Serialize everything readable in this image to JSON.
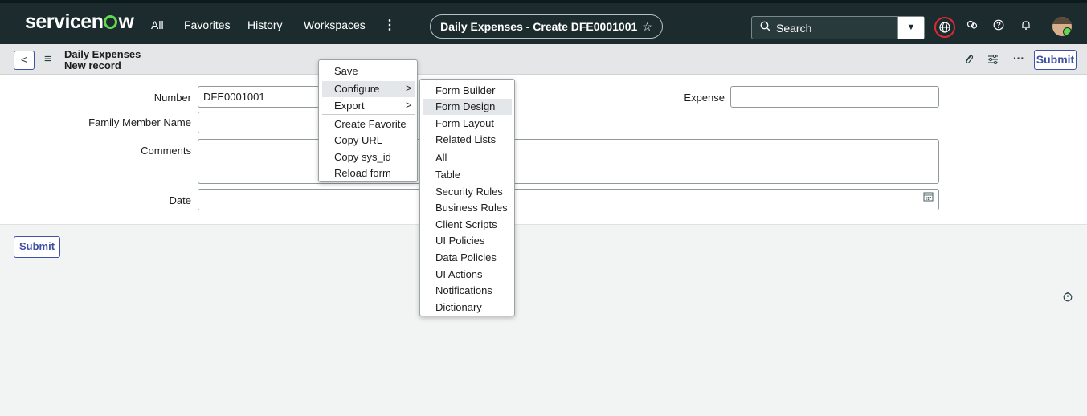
{
  "header": {
    "logo_before": "servicen",
    "logo_after": "w",
    "nav": [
      "All",
      "Favorites",
      "History",
      "Workspaces",
      "⋮"
    ],
    "record_title": "Daily Expenses - Create DFE0001001",
    "search_placeholder": "Search"
  },
  "subheader": {
    "breadcrumb_title": "Daily Expenses",
    "breadcrumb_subtitle": "New record",
    "submit_label": "Submit"
  },
  "form": {
    "number_label": "Number",
    "number_value": "DFE0001001",
    "family_member_label": "Family Member Name",
    "family_member_value": "",
    "expense_label": "Expense",
    "expense_value": "",
    "comments_label": "Comments",
    "comments_value": "",
    "date_label": "Date",
    "date_value": ""
  },
  "footer": {
    "submit_label": "Submit"
  },
  "context_menu": {
    "items": [
      "Save",
      "Configure",
      "Export",
      "Create Favorite",
      "Copy URL",
      "Copy sys_id",
      "Reload form"
    ]
  },
  "configure_submenu": {
    "items": [
      "Form Builder",
      "Form Design",
      "Form Layout",
      "Related Lists",
      "All",
      "Table",
      "Security Rules",
      "Business Rules",
      "Client Scripts",
      "UI Policies",
      "Data Policies",
      "UI Actions",
      "Notifications",
      "Dictionary"
    ]
  },
  "colors": {
    "header_bg": "#1c2b2d",
    "accent": "#3f51a5",
    "brand_green": "#62d84e",
    "highlight": "#e3e7ea"
  }
}
